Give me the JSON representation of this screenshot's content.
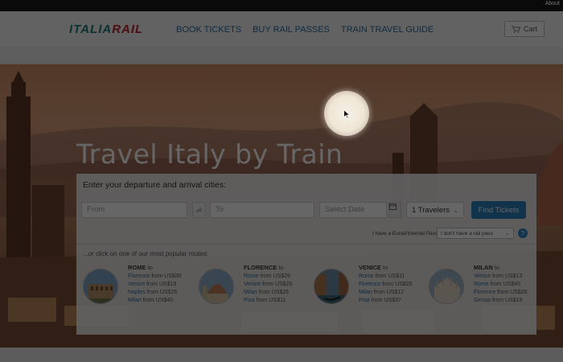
{
  "topbar": {
    "about": "About"
  },
  "header": {
    "logo_part1": "ITALIA",
    "logo_part2": "RAIL",
    "nav": [
      "BOOK TICKETS",
      "BUY RAIL PASSES",
      "TRAIN TRAVEL GUIDE"
    ],
    "cart_label": "Cart",
    "cart_icon": "cart-icon"
  },
  "hero": {
    "title": "Travel Italy by Train"
  },
  "search": {
    "prompt": "Enter your departure and arrival cities:",
    "from_placeholder": "From",
    "to_placeholder": "To",
    "date_placeholder": "Select Date",
    "travelers": "1 Travelers",
    "find_button": "Find Tickets",
    "pass_question": "I have a Eurail/Interrail Pass:",
    "pass_select": "I don't have a rail pass",
    "help": "?"
  },
  "popular": {
    "intro": "...or click on one of our most popular routes:",
    "to_word": "to",
    "from_word": "from",
    "routes": [
      {
        "city": "ROME",
        "items": [
          {
            "dest": "Florence",
            "price": "US$30"
          },
          {
            "dest": "Venice",
            "price": "US$18"
          },
          {
            "dest": "Naples",
            "price": "US$26"
          },
          {
            "dest": "Milan",
            "price": "US$40"
          }
        ]
      },
      {
        "city": "FLORENCE",
        "items": [
          {
            "dest": "Rome",
            "price": "US$26"
          },
          {
            "dest": "Venice",
            "price": "US$26"
          },
          {
            "dest": "Milan",
            "price": "US$26"
          },
          {
            "dest": "Pisa",
            "price": "US$11"
          }
        ]
      },
      {
        "city": "VENICE",
        "items": [
          {
            "dest": "Rome",
            "price": "US$11"
          },
          {
            "dest": "Florence",
            "price": "US$26"
          },
          {
            "dest": "Milan",
            "price": "US$12"
          },
          {
            "dest": "Pisa",
            "price": "US$37"
          }
        ]
      },
      {
        "city": "MILAN",
        "items": [
          {
            "dest": "Venice",
            "price": "US$13"
          },
          {
            "dest": "Rome",
            "price": "US$40"
          },
          {
            "dest": "Florence",
            "price": "US$26"
          },
          {
            "dest": "Genoa",
            "price": "US$19"
          }
        ]
      }
    ]
  },
  "colors": {
    "brand_teal": "#1f7a7a",
    "brand_red": "#c0202a",
    "link_blue": "#2b6a9c",
    "button_blue": "#2b7fbf",
    "overlay": "rgba(0,0,0,0.6)"
  }
}
